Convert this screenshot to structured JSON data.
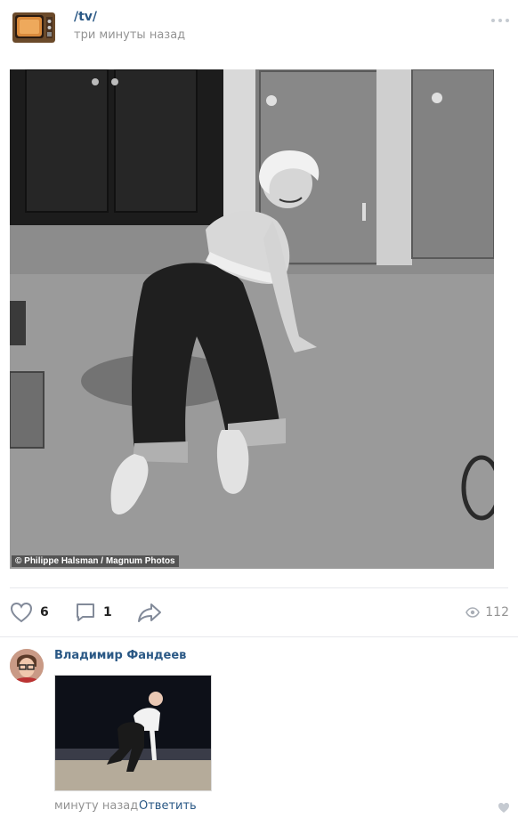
{
  "post": {
    "group_name": "/tv/",
    "time": "три минуты назад",
    "photo_caption": "© Philippe Halsman / Magnum Photos"
  },
  "actions": {
    "likes": "6",
    "comments": "1",
    "views": "112"
  },
  "comment": {
    "author": "Владимир Фандеев",
    "time": "минуту назад",
    "reply_label": "Ответить"
  },
  "icons": {
    "more": "more-dots-icon",
    "like": "heart-icon",
    "comment": "comment-bubble-icon",
    "share": "share-arrow-icon",
    "views": "eye-icon",
    "comment_like": "small-heart-icon"
  },
  "colors": {
    "link": "#2a5885",
    "muted": "#939393",
    "icon": "#828a99",
    "divider": "#e7e8ec"
  }
}
